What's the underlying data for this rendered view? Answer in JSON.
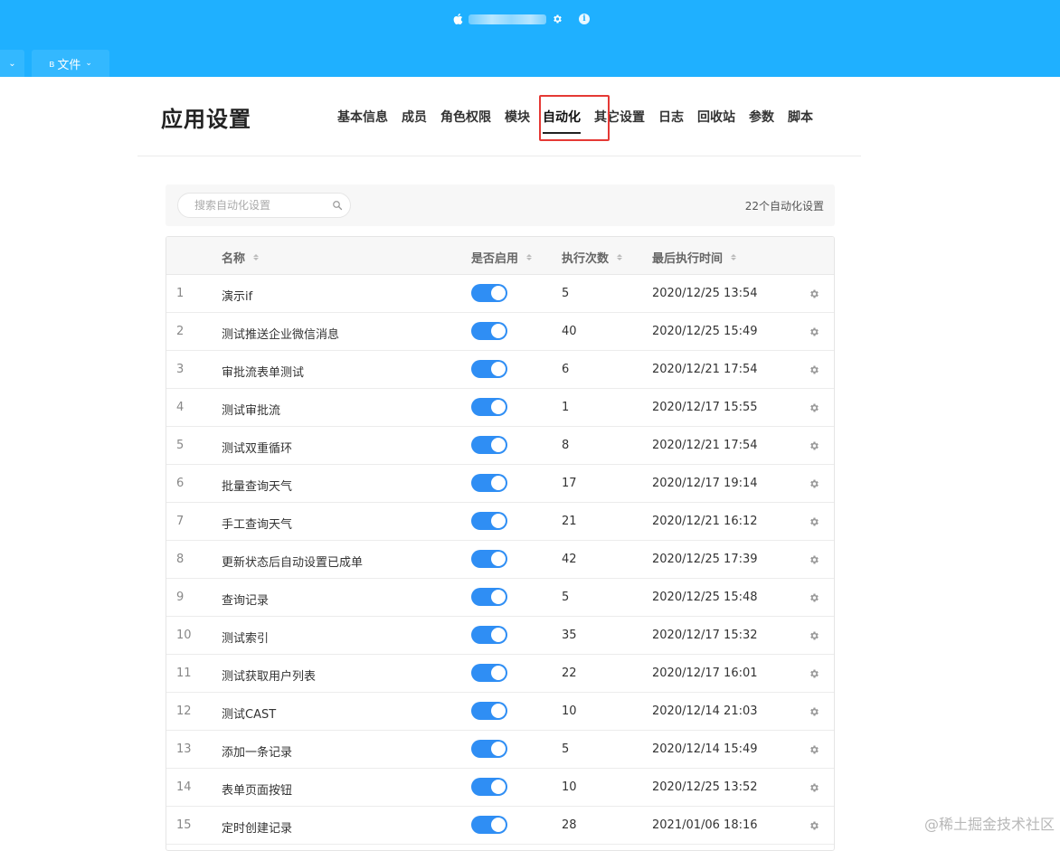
{
  "header": {
    "apple_icon": "apple-icon",
    "settings_icon": "gear-icon",
    "info_icon_text": "i"
  },
  "tabs": {
    "left_chevron": "⌄",
    "file_bt": "ʙ",
    "file_label": "文件",
    "file_chevron": "⌄"
  },
  "page": {
    "title": "应用设置",
    "nav": [
      "基本信息",
      "成员",
      "角色权限",
      "模块",
      "自动化",
      "其它设置",
      "日志",
      "回收站",
      "参数",
      "脚本"
    ],
    "active_nav": "自动化"
  },
  "search": {
    "placeholder": "搜索自动化设置",
    "count_text": "22个自动化设置"
  },
  "table": {
    "headers": {
      "name": "名称",
      "enabled": "是否启用",
      "exec_count": "执行次数",
      "last_exec": "最后执行时间"
    },
    "rows": [
      {
        "idx": "1",
        "name": "演示if",
        "enabled": true,
        "count": "5",
        "time": "2020/12/25 13:54"
      },
      {
        "idx": "2",
        "name": "测试推送企业微信消息",
        "enabled": true,
        "count": "40",
        "time": "2020/12/25 15:49"
      },
      {
        "idx": "3",
        "name": "审批流表单测试",
        "enabled": true,
        "count": "6",
        "time": "2020/12/21 17:54"
      },
      {
        "idx": "4",
        "name": "测试审批流",
        "enabled": true,
        "count": "1",
        "time": "2020/12/17 15:55"
      },
      {
        "idx": "5",
        "name": "测试双重循环",
        "enabled": true,
        "count": "8",
        "time": "2020/12/21 17:54"
      },
      {
        "idx": "6",
        "name": "批量查询天气",
        "enabled": true,
        "count": "17",
        "time": "2020/12/17 19:14"
      },
      {
        "idx": "7",
        "name": "手工查询天气",
        "enabled": true,
        "count": "21",
        "time": "2020/12/21 16:12"
      },
      {
        "idx": "8",
        "name": "更新状态后自动设置已成单",
        "enabled": true,
        "count": "42",
        "time": "2020/12/25 17:39"
      },
      {
        "idx": "9",
        "name": "查询记录",
        "enabled": true,
        "count": "5",
        "time": "2020/12/25 15:48"
      },
      {
        "idx": "10",
        "name": "测试索引",
        "enabled": true,
        "count": "35",
        "time": "2020/12/17 15:32"
      },
      {
        "idx": "11",
        "name": "测试获取用户列表",
        "enabled": true,
        "count": "22",
        "time": "2020/12/17 16:01"
      },
      {
        "idx": "12",
        "name": "测试CAST",
        "enabled": true,
        "count": "10",
        "time": "2020/12/14 21:03"
      },
      {
        "idx": "13",
        "name": "添加一条记录",
        "enabled": true,
        "count": "5",
        "time": "2020/12/14 15:49"
      },
      {
        "idx": "14",
        "name": "表单页面按钮",
        "enabled": true,
        "count": "10",
        "time": "2020/12/25 13:52"
      },
      {
        "idx": "15",
        "name": "定时创建记录",
        "enabled": true,
        "count": "28",
        "time": "2021/01/06 18:16"
      }
    ]
  },
  "watermark": "@稀土掘金技术社区",
  "colors": {
    "topbar": "#1fb0ff",
    "toggle_on": "#2f8ef4",
    "highlight": "#e53935"
  }
}
